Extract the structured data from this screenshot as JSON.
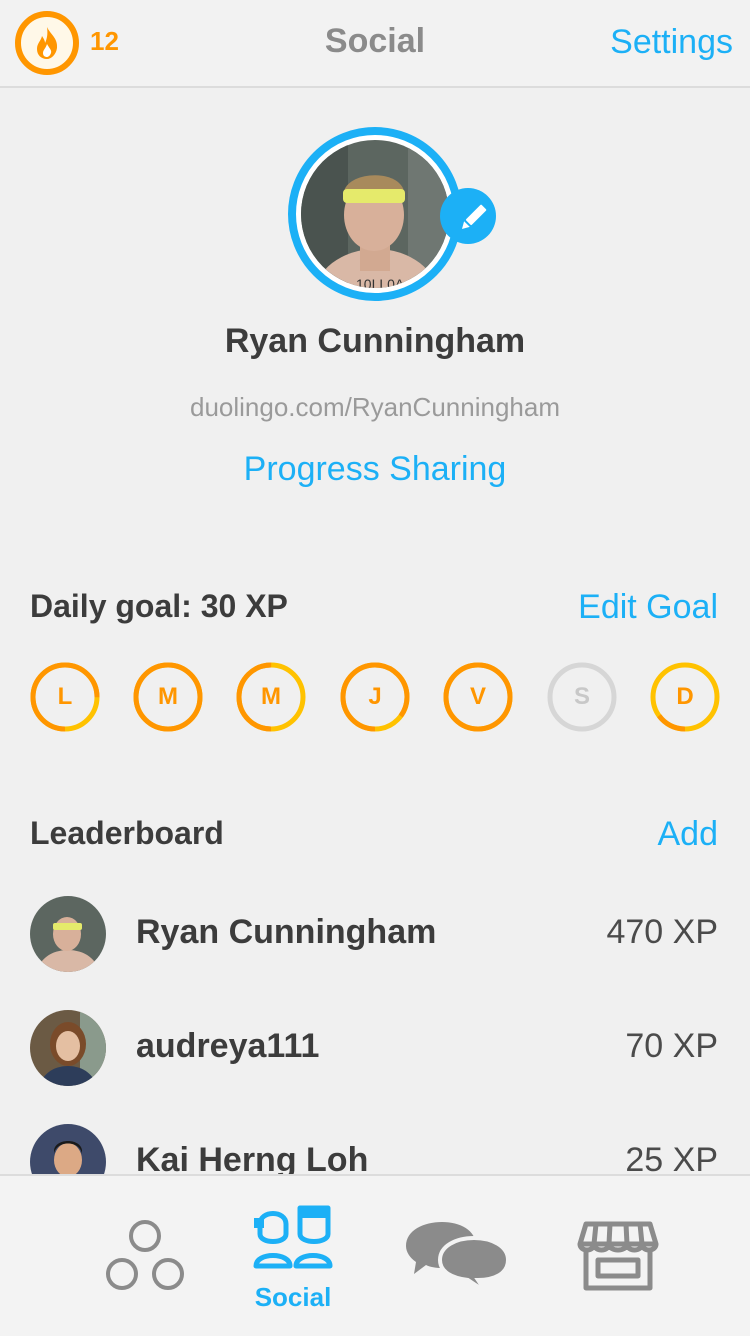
{
  "topbar": {
    "streak_count": "12",
    "title": "Social",
    "settings_label": "Settings"
  },
  "profile": {
    "name": "Ryan Cunningham",
    "url": "duolingo.com/RyanCunningham",
    "progress_sharing_label": "Progress Sharing"
  },
  "daily_goal": {
    "title": "Daily goal: 30 XP",
    "edit_label": "Edit Goal",
    "days": [
      {
        "letter": "L",
        "progress": 0.75,
        "active": true
      },
      {
        "letter": "M",
        "progress": 1.0,
        "active": true
      },
      {
        "letter": "M",
        "progress": 0.5,
        "active": true
      },
      {
        "letter": "J",
        "progress": 0.85,
        "active": true
      },
      {
        "letter": "V",
        "progress": 1.0,
        "active": true
      },
      {
        "letter": "S",
        "progress": 0,
        "active": false
      },
      {
        "letter": "D",
        "progress": 0.15,
        "active": true
      }
    ]
  },
  "leaderboard": {
    "title": "Leaderboard",
    "add_label": "Add",
    "entries": [
      {
        "name": "Ryan Cunningham",
        "xp": "470 XP"
      },
      {
        "name": "audreya111",
        "xp": "70 XP"
      },
      {
        "name": "Kai Herng Loh",
        "xp": "25 XP"
      }
    ]
  },
  "bottom_nav": {
    "items": [
      {
        "icon": "learn-circles-icon"
      },
      {
        "icon": "social-icon",
        "label": "Social",
        "active": true
      },
      {
        "icon": "chat-bubbles-icon"
      },
      {
        "icon": "shop-icon"
      }
    ]
  },
  "colors": {
    "accent": "#1cb0f6",
    "streak": "#ff9600",
    "goal_ring": "#ffc200",
    "goal_ring_progress": "#ff9600",
    "inactive": "#d6d6d6"
  }
}
